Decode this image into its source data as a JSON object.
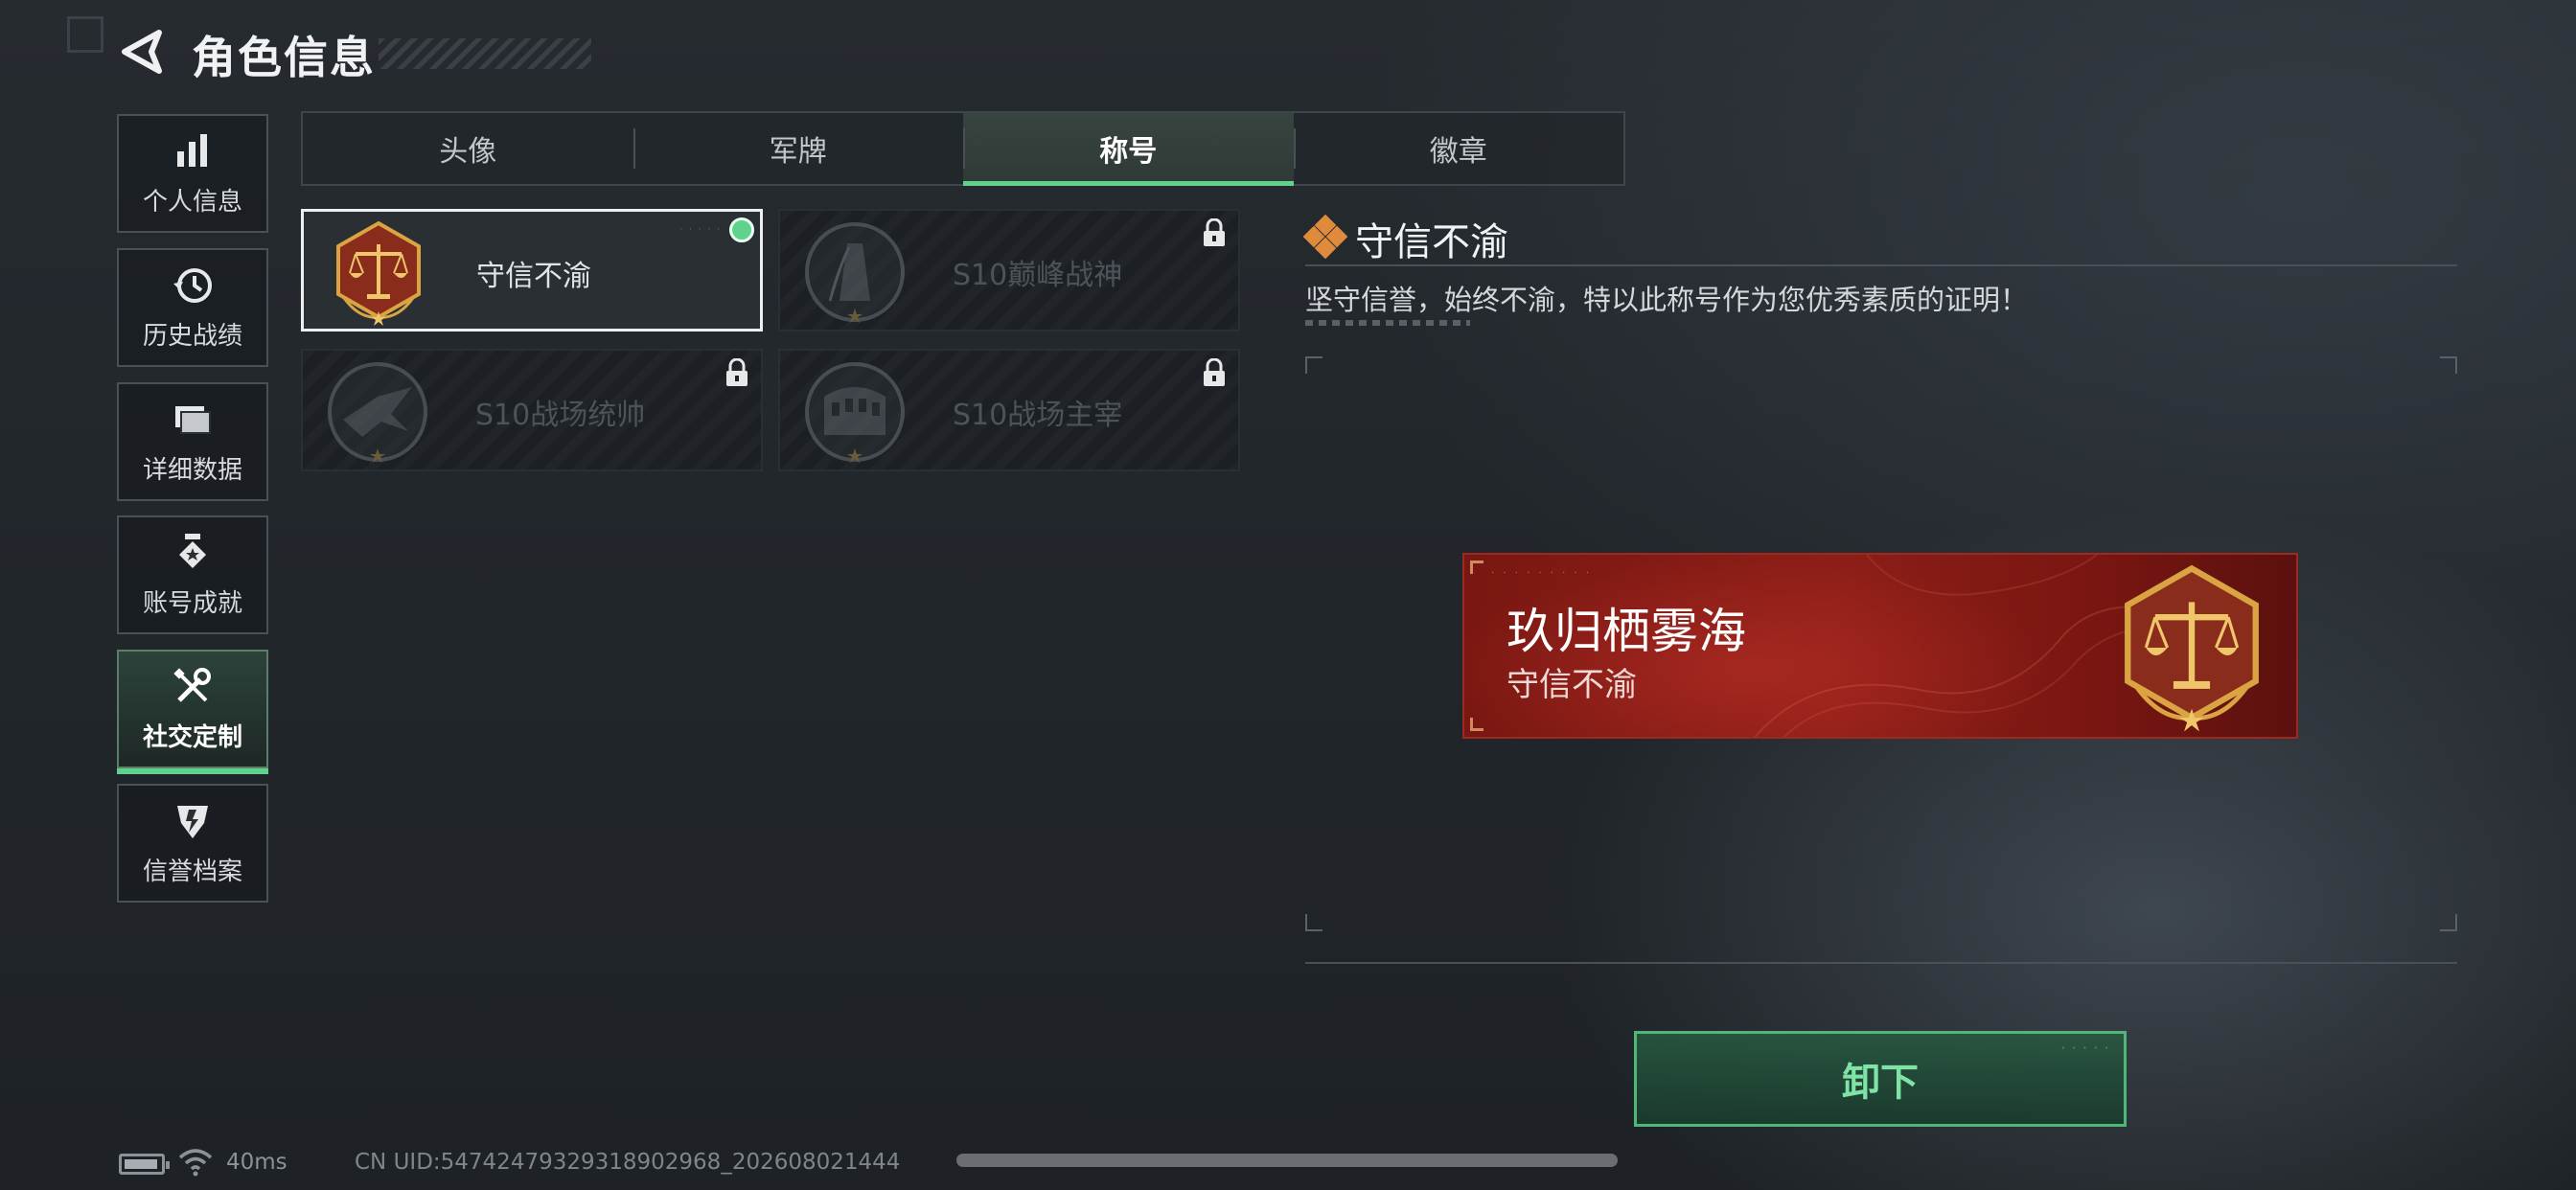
{
  "header": {
    "title": "角色信息"
  },
  "sidebar": {
    "items": [
      {
        "label": "个人信息",
        "icon": "bar-chart-icon",
        "active": false
      },
      {
        "label": "历史战绩",
        "icon": "history-clock-icon",
        "active": false
      },
      {
        "label": "详细数据",
        "icon": "folder-icon",
        "active": false
      },
      {
        "label": "账号成就",
        "icon": "medal-icon",
        "active": false
      },
      {
        "label": "社交定制",
        "icon": "wrench-screwdriver-icon",
        "active": true
      },
      {
        "label": "信誉档案",
        "icon": "shield-emblem-icon",
        "active": false
      }
    ]
  },
  "tabs": [
    {
      "label": "头像",
      "active": false
    },
    {
      "label": "军牌",
      "active": false
    },
    {
      "label": "称号",
      "active": true
    },
    {
      "label": "徽章",
      "active": false
    }
  ],
  "titles": [
    {
      "name": "守信不渝",
      "icon": "scales-emblem-icon",
      "state": "equipped"
    },
    {
      "name": "S10巅峰战神",
      "icon": "tower-emblem-icon",
      "state": "locked"
    },
    {
      "name": "S10战场统帅",
      "icon": "jet-emblem-icon",
      "state": "locked"
    },
    {
      "name": "S10战场主宰",
      "icon": "colosseum-emblem-icon",
      "state": "locked"
    }
  ],
  "detail": {
    "title": "守信不渝",
    "description": "坚守信誉，始终不渝，特以此称号作为您优秀素质的证明！",
    "preview": {
      "player_name": "玖归栖雾海",
      "player_title": "守信不渝"
    },
    "action_label": "卸下"
  },
  "status": {
    "ping": "40ms",
    "uid": "CN UID:5474247932931890​2968_202608021444"
  },
  "colors": {
    "accent": "#5fd38d",
    "banner_red": "#8c1e17",
    "emblem_gold": "#d9a441"
  }
}
